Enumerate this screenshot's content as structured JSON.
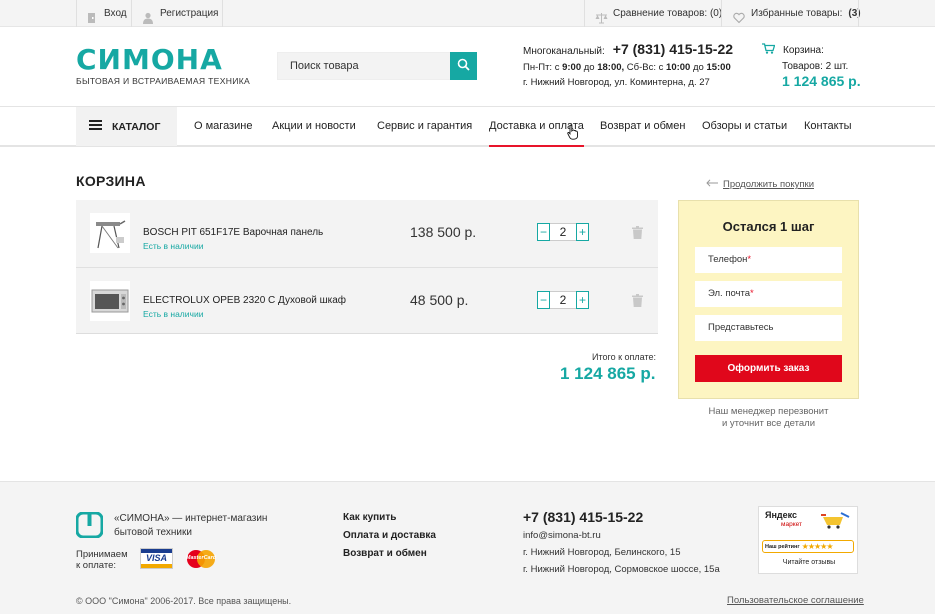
{
  "topbar": {
    "login": "Вход",
    "register": "Регистрация",
    "compare": "Сравнение товаров: (0)",
    "favorites_label": "Избранные товары:",
    "favorites_count": "(3)"
  },
  "header": {
    "logo_main": "СИМОНА",
    "logo_sub": "БЫТОВАЯ И ВСТРАИВАЕМАЯ ТЕХНИКА",
    "search_placeholder": "Поиск товара",
    "multichannel_label": "Многоканальный:",
    "phone": "+7 (831) 415-15-22",
    "hours_a": "Пн-Пт: с",
    "hours_a1": "9:00",
    "hours_a2": "до",
    "hours_a3": "18:00,",
    "hours_b": "Сб-Вс: с",
    "hours_b1": "10:00",
    "hours_b2": "до",
    "hours_b3": "15:00",
    "address": "г. Нижний Новгород, ул. Коминтерна, д. 27",
    "cart_label": "Корзина:",
    "cart_items": "Товаров: 2 шт.",
    "cart_sum": "1 124 865 р."
  },
  "nav": {
    "catalog": "КАТАЛОГ",
    "items": [
      "О магазине",
      "Акции и новости",
      "Сервис и гарантия",
      "Доставка и оплата",
      "Возврат и обмен",
      "Обзоры и статьи",
      "Контакты"
    ]
  },
  "cart": {
    "title": "КОРЗИНА",
    "continue": "Продолжить покупки",
    "items": [
      {
        "name": "BOSCH PIT 651F17E Варочная панель",
        "availability": "Есть в наличии",
        "price": "138 500 р.",
        "qty": "2"
      },
      {
        "name": "ELECTROLUX OPEB 2320 C Духовой шкаф",
        "availability": "Есть в наличии",
        "price": "48 500 р.",
        "qty": "2"
      }
    ],
    "total_label": "Итого к оплате:",
    "total_value": "1 124 865 р."
  },
  "order": {
    "title": "Остался 1 шаг",
    "phone_label": "Телефон",
    "email_label": "Эл. почта",
    "name_label": "Представьтесь",
    "required_mark": "*",
    "submit": "Оформить заказ",
    "note_line1": "Наш менеджер перезвонит",
    "note_line2": "и уточнит все детали"
  },
  "footer": {
    "about_line1": "«СИМОНА» — интернет-магазин",
    "about_line2": "бытовой техники",
    "pay_label_1": "Принимаем",
    "pay_label_2": "к оплате:",
    "visa": "VISA",
    "mastercard": "MasterCard",
    "links": [
      "Как купить",
      "Оплата и доставка",
      "Возврат и обмен"
    ],
    "phone": "+7 (831) 415-15-22",
    "email": "info@simona-bt.ru",
    "address1": "г. Нижний Новгород, Белинского, 15",
    "address2": "г. Нижний Новгород, Сормовское шоссе, 15а",
    "yandex_title": "Яндекс",
    "yandex_sub": "маркет",
    "yandex_rating": "Наш рейтинг",
    "yandex_reviews": "Читайте отзывы",
    "copyright": "© ООО \"Симона\" 2006-2017. Все права защищены.",
    "terms": "Пользовательское соглашение"
  },
  "colors": {
    "brand": "#16a8a3",
    "accent_red": "#e0071b",
    "order_bg": "#fdf5c2"
  }
}
